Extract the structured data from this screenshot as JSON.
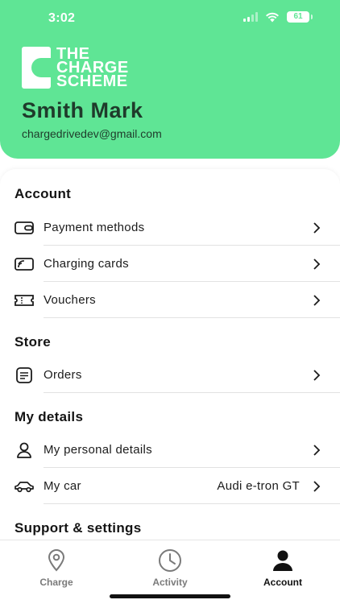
{
  "status_bar": {
    "time": "3:02",
    "battery": "61"
  },
  "brand": {
    "logo_lines": [
      "THE",
      "CHARGE",
      "SCHEME"
    ],
    "color": "#5fe595"
  },
  "user": {
    "name": "Smith Mark",
    "email": "chargedrivedev@gmail.com"
  },
  "sections": {
    "account": {
      "title": "Account",
      "items": [
        {
          "label": "Payment methods",
          "icon": "wallet-icon"
        },
        {
          "label": "Charging cards",
          "icon": "card-icon"
        },
        {
          "label": "Vouchers",
          "icon": "ticket-icon"
        }
      ]
    },
    "store": {
      "title": "Store",
      "items": [
        {
          "label": "Orders",
          "icon": "receipt-icon"
        }
      ]
    },
    "my_details": {
      "title": "My details",
      "items": [
        {
          "label": "My personal details",
          "icon": "person-icon"
        },
        {
          "label": "My car",
          "value": "Audi e-tron GT",
          "icon": "car-icon"
        }
      ]
    },
    "support": {
      "title": "Support & settings"
    }
  },
  "tabs": [
    {
      "label": "Charge",
      "icon": "location-pin-icon",
      "active": false
    },
    {
      "label": "Activity",
      "icon": "clock-icon",
      "active": false
    },
    {
      "label": "Account",
      "icon": "user-icon",
      "active": true
    }
  ]
}
